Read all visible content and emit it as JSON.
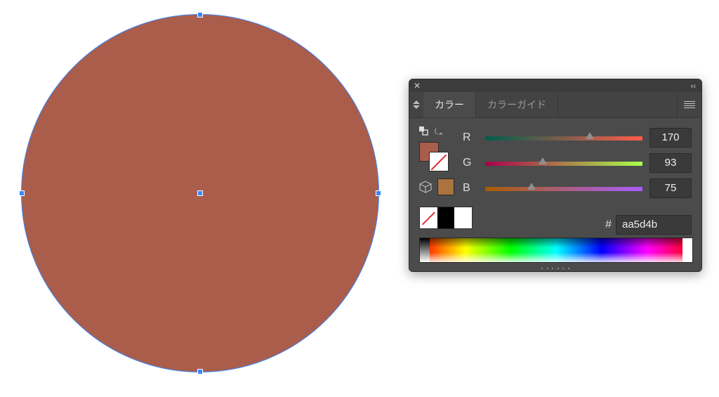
{
  "shape": {
    "fill_color": "#aa5d4b",
    "selection_color": "#3a87ff"
  },
  "panel": {
    "tabs": {
      "color": "カラー",
      "guide": "カラーガイド"
    },
    "channels": {
      "r": {
        "label": "R",
        "value": "170",
        "pct": 66.7,
        "grad": "linear-gradient(90deg,#005d4b,#ff5d4b)"
      },
      "g": {
        "label": "G",
        "value": "93",
        "pct": 36.5,
        "grad": "linear-gradient(90deg,#aa004b,#aaff4b)"
      },
      "b": {
        "label": "B",
        "value": "75",
        "pct": 29.4,
        "grad": "linear-gradient(90deg,#aa5d00,#aa5dff)"
      }
    },
    "hex": {
      "hash": "#",
      "value": "aa5d4b"
    },
    "swatch3": {
      "black": "#000000",
      "white": "#ffffff"
    },
    "cube_color": "#a9743d"
  }
}
